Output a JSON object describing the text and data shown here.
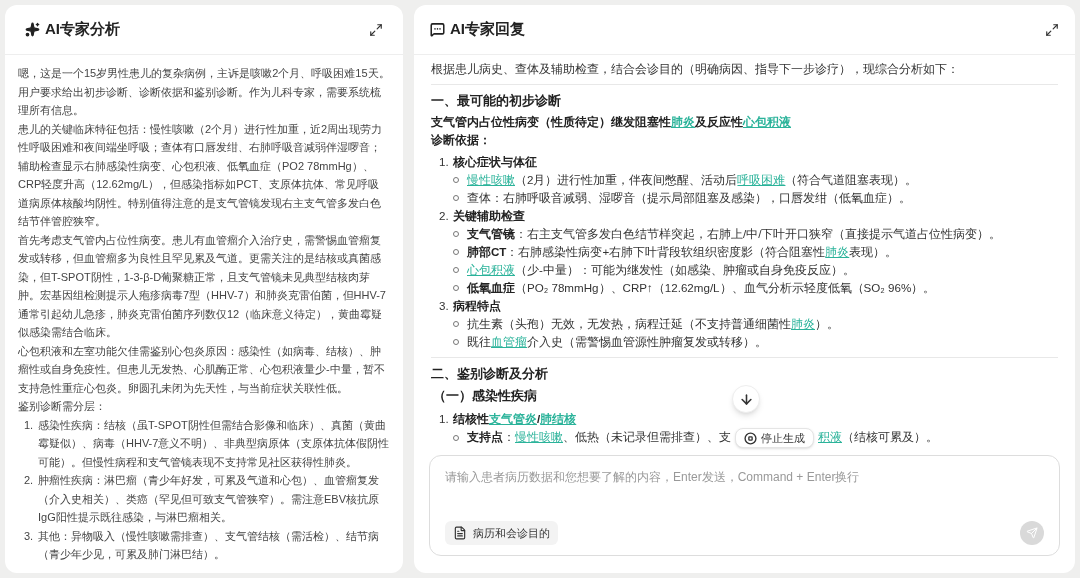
{
  "left_panel": {
    "title": "AI专家分析",
    "paragraphs": [
      "嗯，这是一个15岁男性患儿的复杂病例，主诉是咳嗽2个月、呼吸困难15天。用户要求给出初步诊断、诊断依据和鉴别诊断。作为儿科专家，需要系统梳理所有信息。",
      "患儿的关键临床特征包括：慢性咳嗽（2个月）进行性加重，近2周出现劳力性呼吸困难和夜间端坐呼吸；查体有口唇发绀、右肺呼吸音减弱伴湿啰音；辅助检查显示右肺感染性病变、心包积液、低氧血症（PO2 78mmHg）、CRP轻度升高（12.62mg/L），但感染指标如PCT、支原体抗体、常见呼吸道病原体核酸均阴性。特别值得注意的是支气管镜发现右主支气管多发白色结节伴管腔狭窄。",
      "首先考虑支气管内占位性病变。患儿有血管瘤介入治疗史，需警惕血管瘤复发或转移，但血管瘤多为良性且罕见累及气道。更需关注的是结核或真菌感染，但T-SPOT阴性，1-3-β-D葡聚糖正常，且支气管镜未见典型结核肉芽肿。宏基因组检测提示人疱疹病毒7型（HHV-7）和肺炎克雷伯菌，但HHV-7通常引起幼儿急疹，肺炎克雷伯菌序列数仅12（临床意义待定），黄曲霉疑似感染需结合临床。",
      "心包积液和左室功能欠佳需鉴别心包炎原因：感染性（如病毒、结核）、肿瘤性或自身免疫性。但患儿无发热、心肌酶正常、心包积液量少-中量，暂不支持急性重症心包炎。卵圆孔未闭为先天性，与当前症状关联性低。",
      "鉴别诊断需分层："
    ],
    "list": [
      {
        "number": "1.",
        "text": "感染性疾病：结核（虽T-SPOT阴性但需结合影像和临床）、真菌（黄曲霉疑似）、病毒（HHV-7意义不明）、非典型病原体（支原体抗体假阴性可能）。但慢性病程和支气管镜表现不支持常见社区获得性肺炎。"
      },
      {
        "number": "2.",
        "text": "肿瘤性疾病：淋巴瘤（青少年好发，可累及气道和心包）、血管瘤复发（介入史相关）、类癌（罕见但可致支气管狭窄）。需注意EBV核抗原IgG阳性提示既往感染，与淋巴瘤相关。"
      },
      {
        "number": "3.",
        "text": "其他：异物吸入（慢性咳嗽需排查）、支气管结核（需活检）、结节病（青少年少见，可累及肺门淋巴结）。"
      }
    ]
  },
  "right_panel": {
    "title": "AI专家回复",
    "blocks": [
      {
        "kind": "para",
        "bold": false,
        "segments": [
          {
            "kind": "text",
            "t": "根据患儿病史、查体及辅助检查，结合会诊目的（明确病因、指导下一步诊疗），现综合分析如下："
          }
        ]
      },
      {
        "kind": "rule"
      },
      {
        "kind": "heading",
        "text": "一、最可能的初步诊断"
      },
      {
        "kind": "para",
        "bold": true,
        "segments": [
          {
            "kind": "text",
            "t": "支气管内占位性病变（性质待定）继发阻塞性"
          },
          {
            "kind": "link",
            "t": "肺炎"
          },
          {
            "kind": "text",
            "t": "及反应性"
          },
          {
            "kind": "link",
            "t": "心包积液"
          }
        ]
      },
      {
        "kind": "para",
        "bold": true,
        "segments": [
          {
            "kind": "text",
            "t": "诊断依据："
          }
        ]
      },
      {
        "kind": "list",
        "items": [
          {
            "number": "1.",
            "segments": [
              {
                "kind": "text",
                "t": "核心症状与体征"
              }
            ],
            "children": [
              {
                "segments": [
                  {
                    "kind": "link",
                    "t": "慢性咳嗽"
                  },
                  {
                    "kind": "text",
                    "t": "（2月）进行性加重，伴夜间憋醒、活动后"
                  },
                  {
                    "kind": "link",
                    "t": "呼吸困难"
                  },
                  {
                    "kind": "text",
                    "t": "（符合气道阻塞表现）。"
                  }
                ]
              },
              {
                "segments": [
                  {
                    "kind": "text",
                    "t": "查体：右肺呼吸音减弱、湿啰音（提示局部阻塞及感染），口唇发绀（低氧血症）。"
                  }
                ]
              }
            ]
          },
          {
            "number": "2.",
            "segments": [
              {
                "kind": "text",
                "t": "关键辅助检查"
              }
            ],
            "children": [
              {
                "segments": [
                  {
                    "kind": "bold",
                    "t": "支气管镜"
                  },
                  {
                    "kind": "text",
                    "t": "：右主支气管多发白色结节样突起，右肺上/中/下叶开口狭窄（直接提示气道占位性病变）。"
                  }
                ]
              },
              {
                "segments": [
                  {
                    "kind": "bold",
                    "t": "肺部CT"
                  },
                  {
                    "kind": "text",
                    "t": "：右肺感染性病变+右肺下叶背段软组织密度影（符合阻塞性"
                  },
                  {
                    "kind": "link",
                    "t": "肺炎"
                  },
                  {
                    "kind": "text",
                    "t": "表现）。"
                  }
                ]
              },
              {
                "segments": [
                  {
                    "kind": "link",
                    "t": "心包积液"
                  },
                  {
                    "kind": "text",
                    "t": "（少-中量）：可能为继发性（如感染、肿瘤或自身免疫反应）。"
                  }
                ]
              },
              {
                "segments": [
                  {
                    "kind": "bold",
                    "t": "低氧血症"
                  },
                  {
                    "kind": "text",
                    "t": "（PO₂ 78mmHg）、CRP↑（12.62mg/L）、血气分析示轻度低氧（SO₂ 96%）。"
                  }
                ]
              }
            ]
          },
          {
            "number": "3.",
            "segments": [
              {
                "kind": "text",
                "t": "病程特点"
              }
            ],
            "children": [
              {
                "segments": [
                  {
                    "kind": "text",
                    "t": "抗生素（头孢）无效，无发热，病程迁延（不支持普通细菌性"
                  },
                  {
                    "kind": "link",
                    "t": "肺炎"
                  },
                  {
                    "kind": "text",
                    "t": "）。"
                  }
                ]
              },
              {
                "segments": [
                  {
                    "kind": "text",
                    "t": "既往"
                  },
                  {
                    "kind": "link",
                    "t": "血管瘤"
                  },
                  {
                    "kind": "text",
                    "t": "介入史（需警惕血管源性肿瘤复发或转移）。"
                  }
                ]
              }
            ]
          }
        ]
      },
      {
        "kind": "rule"
      },
      {
        "kind": "heading",
        "text": "二、鉴别诊断及分析"
      },
      {
        "kind": "subheading",
        "text": "（一）感染性疾病"
      },
      {
        "kind": "list",
        "items": [
          {
            "number": "1.",
            "segments": [
              {
                "kind": "text",
                "t": "结核性"
              },
              {
                "kind": "link",
                "t": "支气管炎"
              },
              {
                "kind": "text",
                "t": "/"
              },
              {
                "kind": "link",
                "t": "肺结核"
              }
            ],
            "children": [
              {
                "segments": [
                  {
                    "kind": "bold",
                    "t": "支持点"
                  },
                  {
                    "kind": "text",
                    "t": "："
                  },
                  {
                    "kind": "link",
                    "t": "慢性咳嗽"
                  },
                  {
                    "kind": "text",
                    "t": "、低热（未记录但需排查）、支"
                  },
                  {
                    "kind": "stop"
                  },
                  {
                    "kind": "link",
                    "t": "积液"
                  },
                  {
                    "kind": "text",
                    "t": "（结核可累及）。"
                  }
                ]
              }
            ]
          }
        ]
      }
    ],
    "stop_button": "停止生成",
    "input": {
      "placeholder": "请输入患者病历数据和您想要了解的内容，Enter发送，Command + Enter换行"
    },
    "chip": "病历和会诊目的"
  }
}
